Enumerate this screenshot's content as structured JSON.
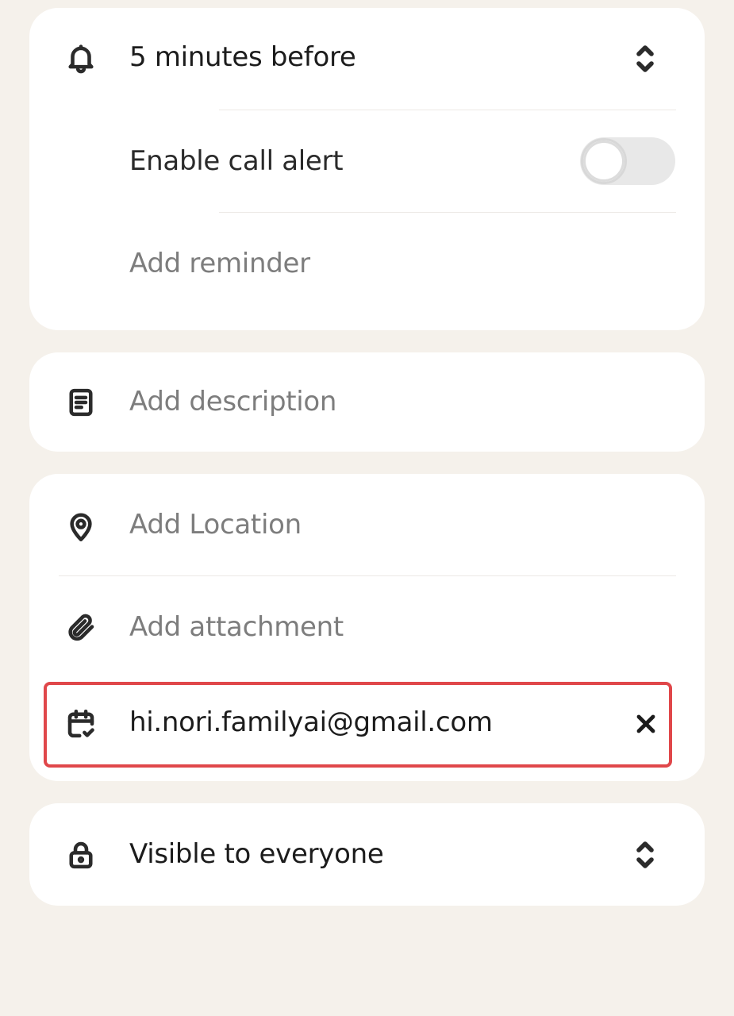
{
  "reminders": {
    "time_value": "5 minutes before",
    "call_alert_label": "Enable call alert",
    "call_alert_enabled": false,
    "add_reminder_label": "Add reminder"
  },
  "description": {
    "placeholder": "Add description"
  },
  "details": {
    "location_placeholder": "Add Location",
    "attachment_placeholder": "Add attachment",
    "calendar_account": "hi.nori.familyai@gmail.com"
  },
  "visibility": {
    "value": "Visible to everyone"
  },
  "colors": {
    "background": "#f5f1eb",
    "card": "#ffffff",
    "highlight": "#e0474a"
  },
  "icons": {
    "reminder": "bell-icon",
    "select": "chevron-up-down-icon",
    "description": "document-icon",
    "location": "map-pin-icon",
    "attachment": "paperclip-icon",
    "calendar": "calendar-check-icon",
    "remove": "close-icon",
    "visibility": "lock-icon"
  }
}
